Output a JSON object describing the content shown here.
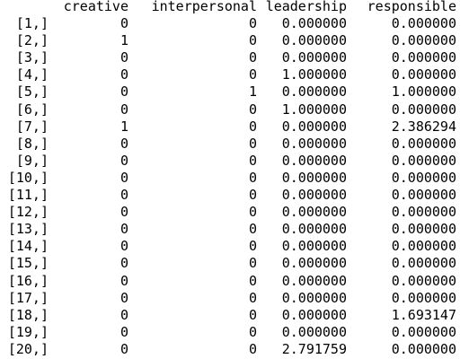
{
  "matrix": {
    "columns": [
      "",
      "creative",
      "interpersonal",
      "leadership",
      "responsible"
    ],
    "rows": [
      [
        "[1,]",
        "0",
        "0",
        "0.000000",
        "0.000000"
      ],
      [
        "[2,]",
        "1",
        "0",
        "0.000000",
        "0.000000"
      ],
      [
        "[3,]",
        "0",
        "0",
        "0.000000",
        "0.000000"
      ],
      [
        "[4,]",
        "0",
        "0",
        "1.000000",
        "0.000000"
      ],
      [
        "[5,]",
        "0",
        "1",
        "0.000000",
        "1.000000"
      ],
      [
        "[6,]",
        "0",
        "0",
        "1.000000",
        "0.000000"
      ],
      [
        "[7,]",
        "1",
        "0",
        "0.000000",
        "2.386294"
      ],
      [
        "[8,]",
        "0",
        "0",
        "0.000000",
        "0.000000"
      ],
      [
        "[9,]",
        "0",
        "0",
        "0.000000",
        "0.000000"
      ],
      [
        "[10,]",
        "0",
        "0",
        "0.000000",
        "0.000000"
      ],
      [
        "[11,]",
        "0",
        "0",
        "0.000000",
        "0.000000"
      ],
      [
        "[12,]",
        "0",
        "0",
        "0.000000",
        "0.000000"
      ],
      [
        "[13,]",
        "0",
        "0",
        "0.000000",
        "0.000000"
      ],
      [
        "[14,]",
        "0",
        "0",
        "0.000000",
        "0.000000"
      ],
      [
        "[15,]",
        "0",
        "0",
        "0.000000",
        "0.000000"
      ],
      [
        "[16,]",
        "0",
        "0",
        "0.000000",
        "0.000000"
      ],
      [
        "[17,]",
        "0",
        "0",
        "0.000000",
        "0.000000"
      ],
      [
        "[18,]",
        "0",
        "0",
        "0.000000",
        "1.693147"
      ],
      [
        "[19,]",
        "0",
        "0",
        "0.000000",
        "0.000000"
      ],
      [
        "[20,]",
        "0",
        "0",
        "2.791759",
        "0.000000"
      ]
    ]
  }
}
